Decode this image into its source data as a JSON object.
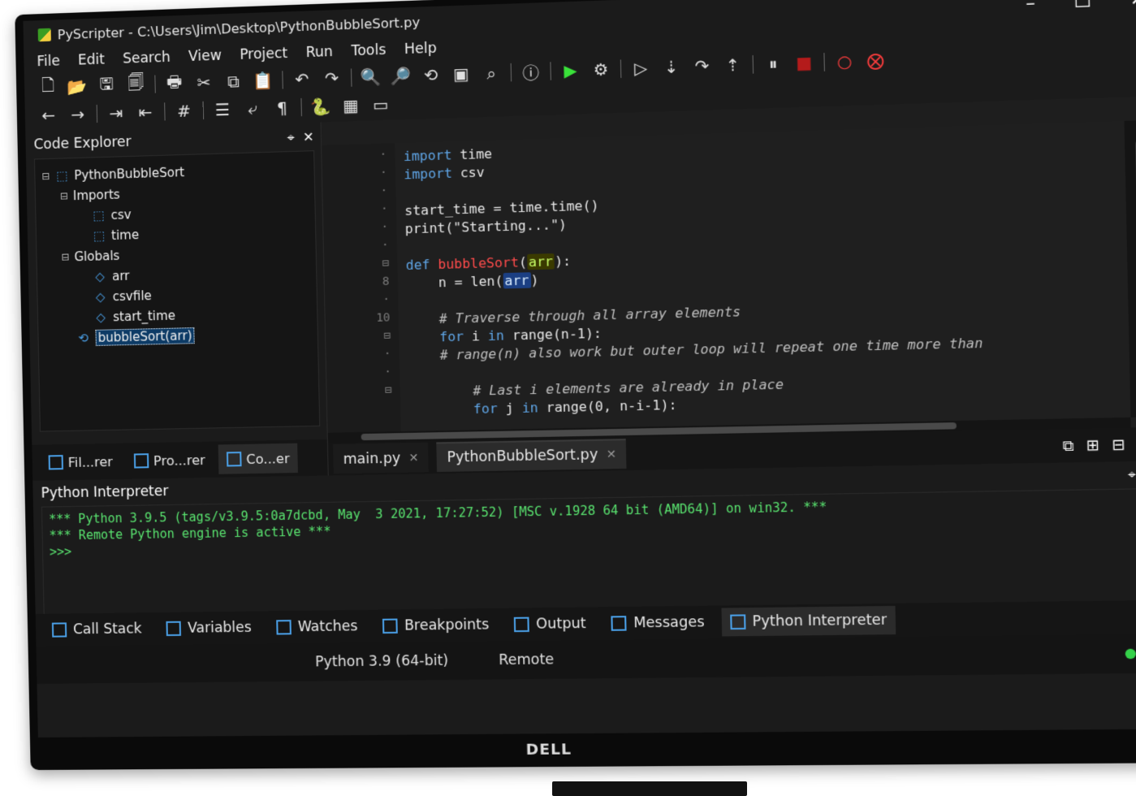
{
  "window": {
    "title": "PyScripter - C:\\Users\\Jim\\Desktop\\PythonBubbleSort.py",
    "controls": {
      "minimize": "–",
      "maximize": "☐",
      "close": "✕"
    }
  },
  "menu": {
    "items": [
      "File",
      "Edit",
      "Search",
      "View",
      "Project",
      "Run",
      "Tools",
      "Help"
    ]
  },
  "toolbar_main": {
    "buttons": [
      {
        "icon": "new-file-icon",
        "glyph": "🗋"
      },
      {
        "icon": "open-file-icon",
        "glyph": "📂"
      },
      {
        "icon": "save-icon",
        "glyph": "🖫"
      },
      {
        "icon": "save-all-icon",
        "glyph": "🗐"
      },
      {
        "icon": "print-icon",
        "glyph": "🖶"
      },
      {
        "icon": "cut-icon",
        "glyph": "✂"
      },
      {
        "icon": "copy-icon",
        "glyph": "⧉"
      },
      {
        "icon": "paste-icon",
        "glyph": "📋"
      },
      {
        "icon": "undo-icon",
        "glyph": "↶"
      },
      {
        "icon": "redo-icon",
        "glyph": "↷"
      },
      {
        "icon": "search-icon",
        "glyph": "🔍"
      },
      {
        "icon": "search-files-icon",
        "glyph": "🔎"
      },
      {
        "icon": "replace-icon",
        "glyph": "⟲"
      },
      {
        "icon": "screenshot-icon",
        "glyph": "▣"
      },
      {
        "icon": "find-icon",
        "glyph": "⌕"
      },
      {
        "icon": "info-icon",
        "glyph": "ⓘ"
      },
      {
        "icon": "run-icon",
        "glyph": "▶"
      },
      {
        "icon": "debug-icon",
        "glyph": "⚙"
      },
      {
        "icon": "run-to-cursor-icon",
        "glyph": "▷"
      },
      {
        "icon": "step-into-icon",
        "glyph": "⇣"
      },
      {
        "icon": "step-over-icon",
        "glyph": "↷"
      },
      {
        "icon": "step-out-icon",
        "glyph": "⇡"
      },
      {
        "icon": "pause-icon",
        "glyph": "⏸"
      },
      {
        "icon": "stop-icon",
        "glyph": "■"
      },
      {
        "icon": "toggle-breakpoint-icon",
        "glyph": "○"
      },
      {
        "icon": "clear-breakpoints-icon",
        "glyph": "⨂"
      }
    ]
  },
  "toolbar_editor": {
    "buttons": [
      {
        "icon": "back-icon",
        "glyph": "←"
      },
      {
        "icon": "forward-icon",
        "glyph": "→"
      },
      {
        "icon": "indent-icon",
        "glyph": "⇥"
      },
      {
        "icon": "dedent-icon",
        "glyph": "⇤"
      },
      {
        "icon": "comment-icon",
        "glyph": "#"
      },
      {
        "icon": "list-icon",
        "glyph": "☰"
      },
      {
        "icon": "wrap-icon",
        "glyph": "⤶"
      },
      {
        "icon": "pilcrow-icon",
        "glyph": "¶"
      },
      {
        "icon": "python-icon",
        "glyph": "🐍"
      },
      {
        "icon": "grid-icon",
        "glyph": "▦"
      },
      {
        "icon": "layout-icon",
        "glyph": "▭"
      }
    ]
  },
  "code_explorer": {
    "title": "Code Explorer",
    "tree": [
      {
        "level": 0,
        "expander": "⊟",
        "icon": "python-module-icon",
        "label": "PythonBubbleSort"
      },
      {
        "level": 1,
        "expander": "⊟",
        "icon": "",
        "label": "Imports"
      },
      {
        "level": 2,
        "expander": "",
        "icon": "import-icon",
        "label": "csv"
      },
      {
        "level": 2,
        "expander": "",
        "icon": "import-icon",
        "label": "time"
      },
      {
        "level": 1,
        "expander": "⊟",
        "icon": "",
        "label": "Globals"
      },
      {
        "level": 2,
        "expander": "",
        "icon": "variable-icon",
        "label": "arr"
      },
      {
        "level": 2,
        "expander": "",
        "icon": "variable-icon",
        "label": "csvfile"
      },
      {
        "level": 2,
        "expander": "",
        "icon": "variable-icon",
        "label": "start_time"
      },
      {
        "level": 1,
        "expander": "",
        "icon": "function-icon",
        "label": "bubbleSort(arr)",
        "selected": true
      }
    ],
    "bottom_tabs": [
      {
        "label": "Fil...rer"
      },
      {
        "label": "Pro...rer"
      },
      {
        "label": "Co...er",
        "active": true
      }
    ]
  },
  "editor": {
    "gutter": [
      "·",
      "·",
      "·",
      "·",
      "·",
      "·",
      "⊟",
      "8",
      "·",
      "10",
      "⊟",
      "·",
      "·",
      "⊟"
    ],
    "code_lines": [
      {
        "text": "import time",
        "segments": [
          [
            "kw",
            "import"
          ],
          [
            "",
            " time"
          ]
        ]
      },
      {
        "text": "import csv",
        "segments": [
          [
            "kw",
            "import"
          ],
          [
            "",
            " csv"
          ]
        ]
      },
      {
        "text": "",
        "segments": [
          [
            "",
            ""
          ]
        ]
      },
      {
        "text": "start_time = time.time()",
        "segments": [
          [
            "",
            "start_time = time.time()"
          ]
        ]
      },
      {
        "text": "print(\"Starting...\")",
        "segments": [
          [
            "",
            "print(\"Starting...\")"
          ]
        ]
      },
      {
        "text": "",
        "segments": [
          [
            "",
            ""
          ]
        ]
      },
      {
        "text": "def bubbleSort(arr):",
        "segments": [
          [
            "kw",
            "def"
          ],
          [
            "",
            " "
          ],
          [
            "fn",
            "bubbleSort"
          ],
          [
            "",
            "("
          ],
          [
            "hl",
            "arr"
          ],
          [
            "",
            "):"
          ]
        ]
      },
      {
        "text": "    n = len(arr)",
        "segments": [
          [
            "",
            "    n = len("
          ],
          [
            "hl-blue",
            "arr"
          ],
          [
            "",
            ")"
          ]
        ]
      },
      {
        "text": "",
        "segments": [
          [
            "",
            ""
          ]
        ]
      },
      {
        "text": "    # Traverse through all array elements",
        "segments": [
          [
            "cm",
            "    # Traverse through all array elements"
          ]
        ]
      },
      {
        "text": "    for i in range(n-1):",
        "segments": [
          [
            "kw",
            "    for"
          ],
          [
            "",
            " i "
          ],
          [
            "kw",
            "in"
          ],
          [
            "",
            " range(n-1):"
          ]
        ]
      },
      {
        "text": "    # range(n) also work but outer loop will repeat one time more than",
        "segments": [
          [
            "cm",
            "    # range(n) also work but outer loop will repeat one time more than"
          ]
        ]
      },
      {
        "text": "",
        "segments": [
          [
            "",
            ""
          ]
        ]
      },
      {
        "text": "        # Last i elements are already in place",
        "segments": [
          [
            "cm",
            "        # Last i elements are already in place"
          ]
        ]
      },
      {
        "text": "        for j in range(0, n-i-1):",
        "segments": [
          [
            "kw",
            "        for"
          ],
          [
            "",
            " j "
          ],
          [
            "kw",
            "in"
          ],
          [
            "",
            " range(0, n-i-1):"
          ]
        ]
      }
    ],
    "tabs": [
      {
        "label": "main.py",
        "close": "✕"
      },
      {
        "label": "PythonBubbleSort.py",
        "close": "✕",
        "active": true
      }
    ],
    "tab_actions": [
      {
        "icon": "window-list-icon",
        "glyph": "⧉"
      },
      {
        "icon": "new-tab-icon",
        "glyph": "⊞"
      },
      {
        "icon": "split-tab-icon",
        "glyph": "⊟"
      },
      {
        "icon": "close-tab-icon",
        "glyph": "▭"
      }
    ]
  },
  "python_interpreter": {
    "title": "Python Interpreter",
    "console_lines": [
      "*** Python 3.9.5 (tags/v3.9.5:0a7dcbd, May  3 2021, 17:27:52) [MSC v.1928 64 bit (AMD64)] on win32. ***",
      "*** Remote Python engine is active ***",
      ">>>"
    ],
    "tabs": [
      {
        "label": "Call Stack"
      },
      {
        "label": "Variables"
      },
      {
        "label": "Watches"
      },
      {
        "label": "Breakpoints"
      },
      {
        "label": "Output"
      },
      {
        "label": "Messages"
      },
      {
        "label": "Python Interpreter",
        "active": true
      }
    ]
  },
  "status_bar": {
    "items": [
      "Python 3.9 (64-bit)",
      "Remote"
    ]
  },
  "monitor": {
    "brand": "DELL"
  },
  "colors": {
    "background": "#1b1b1b",
    "editor_bg": "#1f1f1f",
    "keyword": "#5fa5e6",
    "function": "#ff4b4b",
    "console_text": "#59e36f",
    "status_dot": "#35d14a"
  }
}
